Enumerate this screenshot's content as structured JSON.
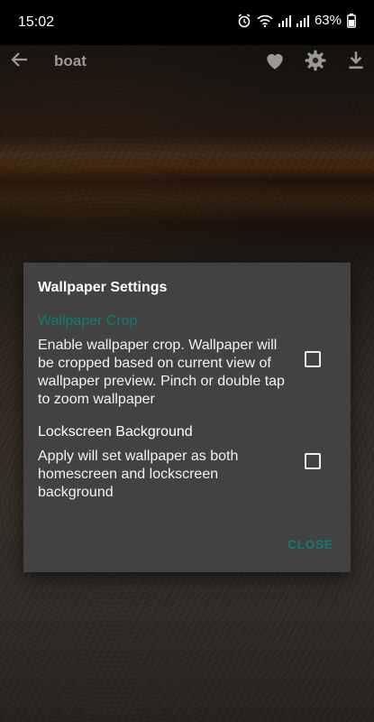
{
  "status_bar": {
    "time": "15:02",
    "battery": "63%",
    "icons": [
      "alarm-icon",
      "wifi-icon",
      "signal-icon",
      "signal-icon",
      "battery-icon"
    ]
  },
  "app_bar": {
    "title": "boat",
    "icons": [
      "back-arrow-icon",
      "heart-icon",
      "gear-icon",
      "download-icon"
    ]
  },
  "dialog": {
    "title": "Wallpaper Settings",
    "crop": {
      "header": "Wallpaper Crop",
      "text": "Enable wallpaper crop. Wallpaper will be cropped based on current view of wallpaper preview. Pinch or double tap to zoom wallpaper",
      "checked": false
    },
    "lockscreen": {
      "header": "Lockscreen Background",
      "text": "Apply will set wallpaper as both homescreen and lockscreen background",
      "checked": false
    },
    "close_label": "CLOSE"
  },
  "colors": {
    "accent": "#107a73",
    "dialog_bg": "#424242"
  }
}
